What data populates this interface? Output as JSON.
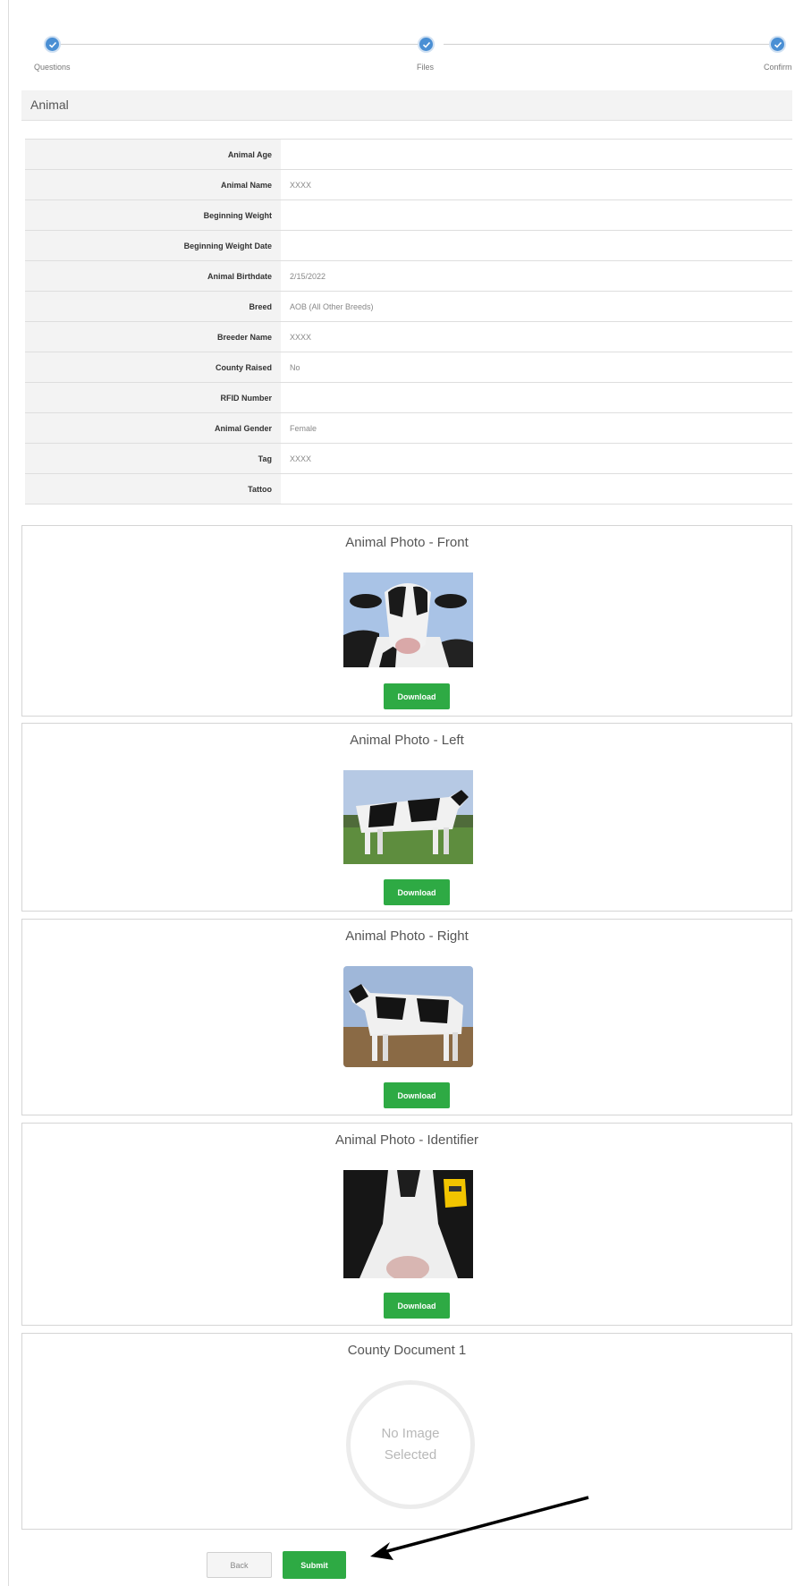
{
  "stepper": {
    "steps": [
      {
        "label": "Questions"
      },
      {
        "label": "Files"
      },
      {
        "label": "Confirm"
      }
    ]
  },
  "section": {
    "title": "Animal"
  },
  "details": [
    {
      "label": "Animal Age",
      "value": ""
    },
    {
      "label": "Animal Name",
      "value": "XXXX"
    },
    {
      "label": "Beginning Weight",
      "value": ""
    },
    {
      "label": "Beginning Weight Date",
      "value": ""
    },
    {
      "label": "Animal Birthdate",
      "value": "2/15/2022"
    },
    {
      "label": "Breed",
      "value": "AOB (All Other Breeds)"
    },
    {
      "label": "Breeder Name",
      "value": "XXXX"
    },
    {
      "label": "County Raised",
      "value": "No"
    },
    {
      "label": "RFID Number",
      "value": ""
    },
    {
      "label": "Animal Gender",
      "value": "Female"
    },
    {
      "label": "Tag",
      "value": "XXXX"
    },
    {
      "label": "Tattoo",
      "value": ""
    }
  ],
  "photos": [
    {
      "title": "Animal Photo - Front",
      "download_label": "Download"
    },
    {
      "title": "Animal Photo - Left",
      "download_label": "Download"
    },
    {
      "title": "Animal Photo - Right",
      "download_label": "Download"
    },
    {
      "title": "Animal Photo - Identifier",
      "download_label": "Download"
    }
  ],
  "document": {
    "title": "County Document 1",
    "placeholder_line1": "No Image",
    "placeholder_line2": "Selected"
  },
  "actions": {
    "back_label": "Back",
    "submit_label": "Submit"
  },
  "colors": {
    "accent": "#4a8fd4",
    "button_green": "#2eaa44"
  }
}
